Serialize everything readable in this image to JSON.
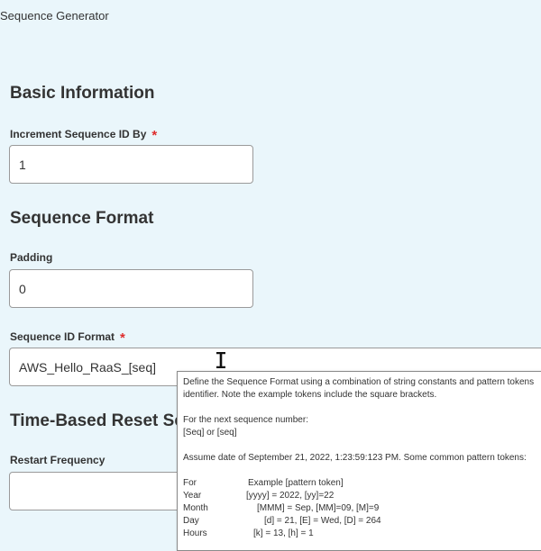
{
  "app": {
    "title": "Sequence Generator"
  },
  "basic_information": {
    "heading": "Basic Information",
    "increment_label": "Increment Sequence ID By",
    "increment_value": "1"
  },
  "sequence_format": {
    "heading": "Sequence Format",
    "padding_label": "Padding",
    "padding_value": "0",
    "format_label": "Sequence ID Format",
    "format_value": "AWS_Hello_RaaS_[seq]"
  },
  "time_based_reset": {
    "heading": "Time-Based Reset Se",
    "restart_label": "Restart Frequency",
    "restart_value": ""
  },
  "required_marker": "*",
  "tooltip": {
    "intro_1": "Define the Sequence Format using a combination of string constants and pattern tokens",
    "intro_2": "identifier. Note the example tokens include the square brackets.",
    "next_label": "For the next sequence number:",
    "next_value": "[Seq] or [seq]",
    "assume": "Assume date of September 21, 2022, 1:23:59:123 PM.  Some common pattern tokens:",
    "table": {
      "header_key": "For",
      "header_value": "Example [pattern token]",
      "rows": [
        {
          "key": "Year",
          "value": "[yyyy] = 2022, [yy]=22"
        },
        {
          "key": "Month",
          "value": "[MMM] = Sep, [MM]=09, [M]=9"
        },
        {
          "key": "Day",
          "value": "[d] = 21, [E] = Wed, [D] = 264"
        },
        {
          "key": "Hours",
          "value": "[k] = 13, [h] = 1"
        }
      ]
    }
  },
  "colors": {
    "background": "#eaf6fb",
    "required": "#de2c2c",
    "field_border": "#9a9a9a"
  }
}
